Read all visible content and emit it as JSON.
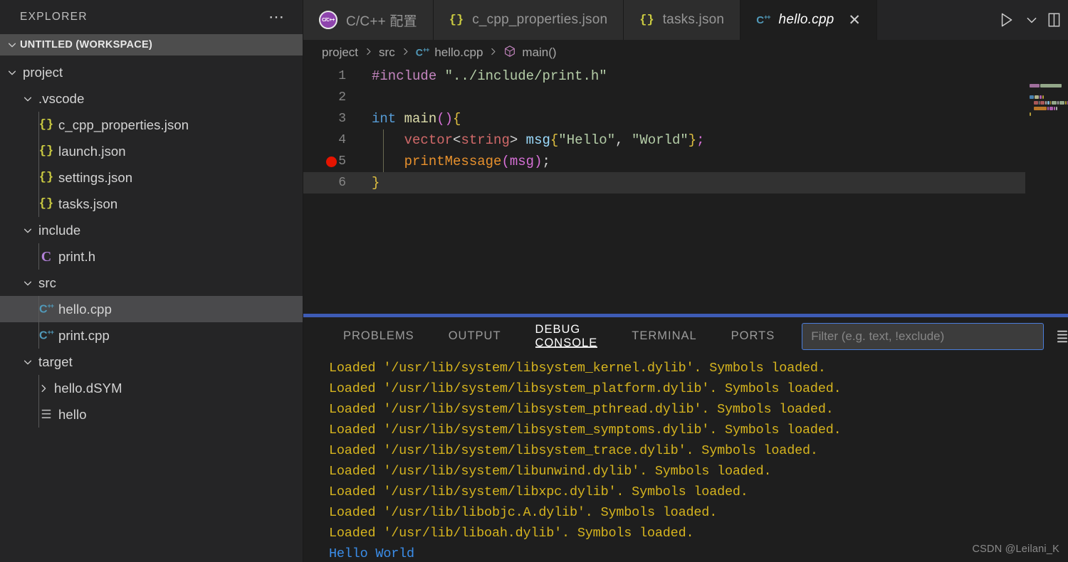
{
  "sidebar": {
    "title": "EXPLORER",
    "actions_icon": "more-horizontal-icon",
    "workspace": "UNTITLED (WORKSPACE)",
    "tree": [
      {
        "label": "project",
        "indent": 1,
        "kind": "folder",
        "expanded": true,
        "selected": false
      },
      {
        "label": ".vscode",
        "indent": 2,
        "kind": "folder",
        "expanded": true,
        "selected": false
      },
      {
        "label": "c_cpp_properties.json",
        "indent": 3,
        "kind": "json",
        "selected": false
      },
      {
        "label": "launch.json",
        "indent": 3,
        "kind": "json",
        "selected": false
      },
      {
        "label": "settings.json",
        "indent": 3,
        "kind": "json",
        "selected": false
      },
      {
        "label": "tasks.json",
        "indent": 3,
        "kind": "json",
        "selected": false
      },
      {
        "label": "include",
        "indent": 2,
        "kind": "folder",
        "expanded": true,
        "selected": false
      },
      {
        "label": "print.h",
        "indent": 3,
        "kind": "header",
        "selected": false
      },
      {
        "label": "src",
        "indent": 2,
        "kind": "folder",
        "expanded": true,
        "selected": false
      },
      {
        "label": "hello.cpp",
        "indent": 3,
        "kind": "cpp",
        "selected": true
      },
      {
        "label": "print.cpp",
        "indent": 3,
        "kind": "cpp",
        "selected": false
      },
      {
        "label": "target",
        "indent": 2,
        "kind": "folder",
        "expanded": true,
        "selected": false
      },
      {
        "label": "hello.dSYM",
        "indent": 3,
        "kind": "folder",
        "expanded": false,
        "selected": false
      },
      {
        "label": "hello",
        "indent": 3,
        "kind": "binary",
        "selected": false
      }
    ]
  },
  "tabs": [
    {
      "label": "C/C++ 配置",
      "icon": "cpp-extension-icon",
      "active": false,
      "closable": false
    },
    {
      "label": "c_cpp_properties.json",
      "icon": "json-icon",
      "active": false,
      "closable": false
    },
    {
      "label": "tasks.json",
      "icon": "json-icon",
      "active": false,
      "closable": false
    },
    {
      "label": "hello.cpp",
      "icon": "cpp-icon",
      "active": true,
      "closable": true
    }
  ],
  "tab_actions": [
    {
      "name": "run-button",
      "icon": "play-outline-icon"
    },
    {
      "name": "run-options-button",
      "icon": "chevron-down-icon"
    },
    {
      "name": "split-editor-button",
      "icon": "split-editor-icon"
    }
  ],
  "breadcrumb": [
    {
      "label": "project",
      "icon": null
    },
    {
      "label": "src",
      "icon": null
    },
    {
      "label": "hello.cpp",
      "icon": "cpp-icon"
    },
    {
      "label": "main()",
      "icon": "symbol-method-icon"
    }
  ],
  "editor": {
    "language": "cpp",
    "breakpoint_line": 5,
    "current_line": 6,
    "lines": [
      {
        "n": 1,
        "tokens": [
          {
            "t": "#include ",
            "c": "t-pre"
          },
          {
            "t": "\"../include/print.h\"",
            "c": "t-strg"
          }
        ]
      },
      {
        "n": 2,
        "tokens": []
      },
      {
        "n": 3,
        "tokens": [
          {
            "t": "int ",
            "c": "t-kw"
          },
          {
            "t": "main",
            "c": "t-fn"
          },
          {
            "t": "()",
            "c": "t-brc2"
          },
          {
            "t": "{",
            "c": "t-brc"
          }
        ]
      },
      {
        "n": 4,
        "tokens": [
          {
            "t": "    ",
            "c": "t-punc"
          },
          {
            "t": "vector",
            "c": "t-type"
          },
          {
            "t": "<",
            "c": "t-punc"
          },
          {
            "t": "string",
            "c": "t-type"
          },
          {
            "t": "> ",
            "c": "t-punc"
          },
          {
            "t": "msg",
            "c": "t-var"
          },
          {
            "t": "{",
            "c": "t-brc"
          },
          {
            "t": "\"Hello\"",
            "c": "t-strg"
          },
          {
            "t": ", ",
            "c": "t-punc"
          },
          {
            "t": "\"World\"",
            "c": "t-strg"
          },
          {
            "t": "}",
            "c": "t-brc"
          },
          {
            "t": ";",
            "c": "t-pink"
          }
        ]
      },
      {
        "n": 5,
        "tokens": [
          {
            "t": "    ",
            "c": "t-punc"
          },
          {
            "t": "printMessage",
            "c": "t-fnor"
          },
          {
            "t": "(",
            "c": "t-brc2"
          },
          {
            "t": "msg",
            "c": "t-pink"
          },
          {
            "t": ")",
            "c": "t-brc2"
          },
          {
            "t": ";",
            "c": "t-punc"
          }
        ]
      },
      {
        "n": 6,
        "tokens": [
          {
            "t": "}",
            "c": "t-brc"
          }
        ]
      }
    ]
  },
  "panel": {
    "tabs": [
      {
        "label": "PROBLEMS",
        "active": false
      },
      {
        "label": "OUTPUT",
        "active": false
      },
      {
        "label": "DEBUG CONSOLE",
        "active": true
      },
      {
        "label": "TERMINAL",
        "active": false
      },
      {
        "label": "PORTS",
        "active": false
      }
    ],
    "filter_placeholder": "Filter (e.g. text, !exclude)",
    "filter_value": "",
    "actions_icon": "panel-more-icon",
    "console_lines": [
      {
        "text": "Loaded '/usr/lib/system/libsystem_kernel.dylib'. Symbols loaded.",
        "kind": "load"
      },
      {
        "text": "Loaded '/usr/lib/system/libsystem_platform.dylib'. Symbols loaded.",
        "kind": "load"
      },
      {
        "text": "Loaded '/usr/lib/system/libsystem_pthread.dylib'. Symbols loaded.",
        "kind": "load"
      },
      {
        "text": "Loaded '/usr/lib/system/libsystem_symptoms.dylib'. Symbols loaded.",
        "kind": "load"
      },
      {
        "text": "Loaded '/usr/lib/system/libsystem_trace.dylib'. Symbols loaded.",
        "kind": "load"
      },
      {
        "text": "Loaded '/usr/lib/system/libunwind.dylib'. Symbols loaded.",
        "kind": "load"
      },
      {
        "text": "Loaded '/usr/lib/system/libxpc.dylib'. Symbols loaded.",
        "kind": "load"
      },
      {
        "text": "Loaded '/usr/lib/libobjc.A.dylib'. Symbols loaded.",
        "kind": "load"
      },
      {
        "text": "Loaded '/usr/lib/liboah.dylib'. Symbols loaded.",
        "kind": "load"
      },
      {
        "text": "Hello World",
        "kind": "output"
      }
    ]
  },
  "watermark": "CSDN @Leilani_K",
  "colors": {
    "accent_blue": "#3e5bb5",
    "breakpoint_red": "#e51400",
    "console_load": "#d6b41e",
    "console_output": "#3b8eea",
    "selection_gray": "#4a4a4c"
  }
}
